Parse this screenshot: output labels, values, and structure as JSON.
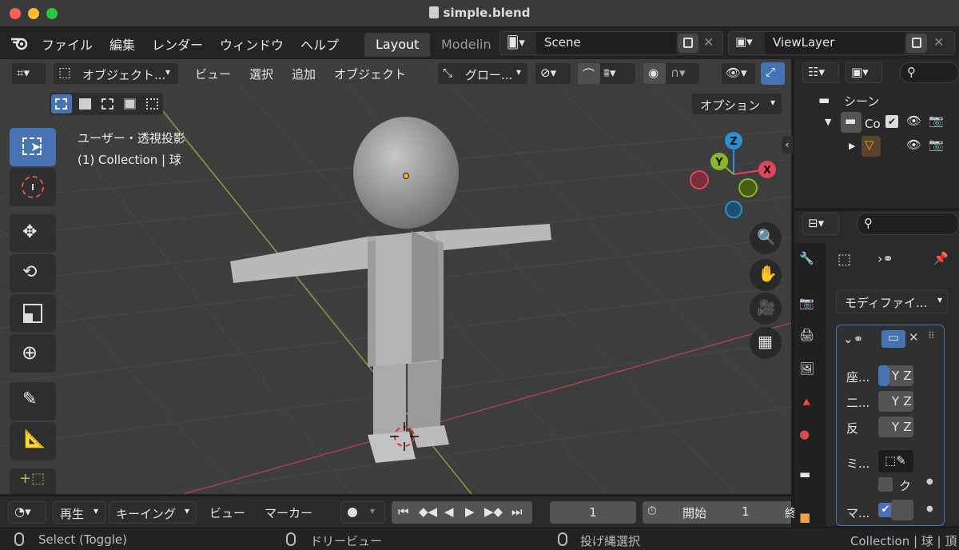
{
  "window": {
    "title": "simple.blend"
  },
  "menubar": {
    "items": [
      "ファイル",
      "編集",
      "レンダー",
      "ウィンドウ",
      "ヘルプ"
    ],
    "tabs": [
      "Layout",
      "Modelin"
    ],
    "scene": "Scene",
    "view_layer": "ViewLayer"
  },
  "viewport": {
    "mode_label": "オブジェクト...",
    "menus": [
      "ビュー",
      "選択",
      "追加",
      "オブジェクト"
    ],
    "transform_orientation": "グロー...",
    "options_label": "オプション",
    "view_info": "ユーザー・透視投影",
    "collection_info": "(1) Collection | 球",
    "gizmo_axes": {
      "z": "Z",
      "y": "Y",
      "x": "X"
    }
  },
  "timeline": {
    "playback_label": "再生",
    "keying_label": "キーイング",
    "view_label": "ビュー",
    "marker_label": "マーカー",
    "current_frame": "1",
    "start_label": "開始",
    "start_frame": "1",
    "end_label_partial": "終"
  },
  "statusbar": {
    "left": "Select (Toggle)",
    "middle": "ドリービュー",
    "right_hint": "投げ縄選択",
    "info": "Collection | 球 | 頂"
  },
  "outliner": {
    "scene_label": "シーン",
    "collection_label": "Co"
  },
  "properties": {
    "modifier_dropdown": "モディファイ...",
    "axis_label": "座...",
    "bisect_label": "二...",
    "flip_label": "反",
    "mirror_object_label": "ミ...",
    "clip_label": "ク",
    "merge_label": "マ...",
    "axis_y": "Y",
    "axis_z": "Z"
  },
  "colors": {
    "accent_blue": "#4772b3",
    "x_axis": "#e0475c",
    "y_axis": "#88b827",
    "z_axis": "#2b8fd6"
  }
}
